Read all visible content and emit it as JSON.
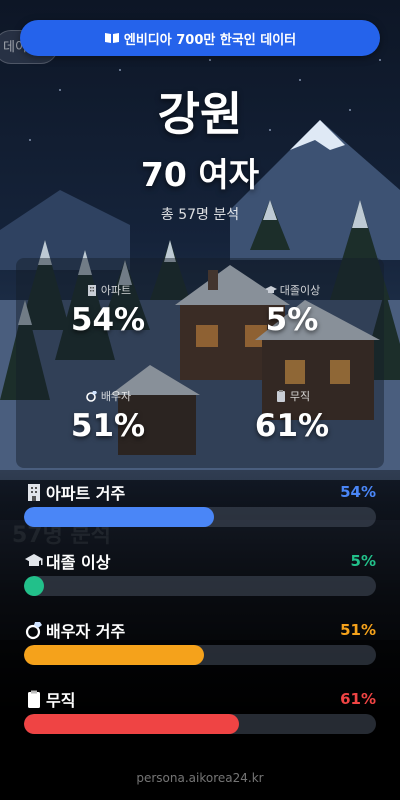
{
  "top_pill": {
    "label": "엔비디아 700만 한국인 데이터",
    "icon": "book-icon",
    "color": "#2563eb"
  },
  "ghost_tab": {
    "label": "데이"
  },
  "header": {
    "region": "강원",
    "persona": "70 여자",
    "sample": "총 57명 분석"
  },
  "stats": [
    {
      "label": "아파트",
      "value": "54%",
      "icon": "apartment-icon"
    },
    {
      "label": "대졸이상",
      "value": "5%",
      "icon": "graduation-cap-icon"
    },
    {
      "label": "배우자",
      "value": "51%",
      "icon": "ring-icon"
    },
    {
      "label": "무직",
      "value": "61%",
      "icon": "clipboard-icon"
    }
  ],
  "bars": [
    {
      "label": "아파트 거주",
      "pct_label": "54%",
      "value": 54,
      "color": "#4a86f7",
      "icon": "apartment-icon"
    },
    {
      "label": "대졸 이상",
      "pct_label": "5%",
      "value": 5,
      "color": "#22c08a",
      "icon": "graduation-cap-icon"
    },
    {
      "label": "배우자 거주",
      "pct_label": "51%",
      "value": 51,
      "color": "#f5a21b",
      "icon": "ring-icon"
    },
    {
      "label": "무직",
      "pct_label": "61%",
      "value": 61,
      "color": "#ef4444",
      "icon": "clipboard-icon"
    }
  ],
  "footer": {
    "text": "persona.aikorea24.kr"
  }
}
